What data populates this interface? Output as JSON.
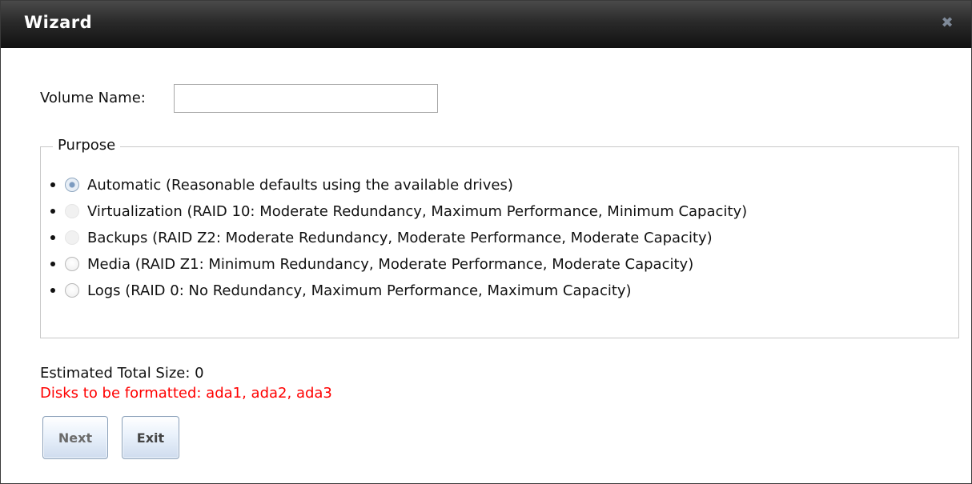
{
  "window": {
    "title": "Wizard",
    "close_icon": "close-icon"
  },
  "form": {
    "volume_name_label": "Volume Name:",
    "volume_name_value": "",
    "volume_name_placeholder": ""
  },
  "purpose": {
    "legend": "Purpose",
    "selected": "Automatic",
    "options": [
      {
        "label": "Automatic (Reasonable defaults using the available drives)",
        "checked": true,
        "disabled": false
      },
      {
        "label": "Virtualization (RAID 10: Moderate Redundancy, Maximum Performance, Minimum Capacity)",
        "checked": false,
        "disabled": true
      },
      {
        "label": "Backups (RAID Z2: Moderate Redundancy, Moderate Performance, Moderate Capacity)",
        "checked": false,
        "disabled": true
      },
      {
        "label": "Media (RAID Z1: Minimum Redundancy, Moderate Performance, Moderate Capacity)",
        "checked": false,
        "disabled": false
      },
      {
        "label": "Logs (RAID 0: No Redundancy, Maximum Performance, Maximum Capacity)",
        "checked": false,
        "disabled": false
      }
    ]
  },
  "summary": {
    "estimated_size": "Estimated Total Size: 0",
    "disks_warning": "Disks to be formatted: ada1, ada2, ada3"
  },
  "buttons": {
    "next_label": "Next",
    "exit_label": "Exit"
  },
  "colors": {
    "titlebar": "#222222",
    "warning": "#ff0000",
    "button_accent": "#cfdcee"
  }
}
